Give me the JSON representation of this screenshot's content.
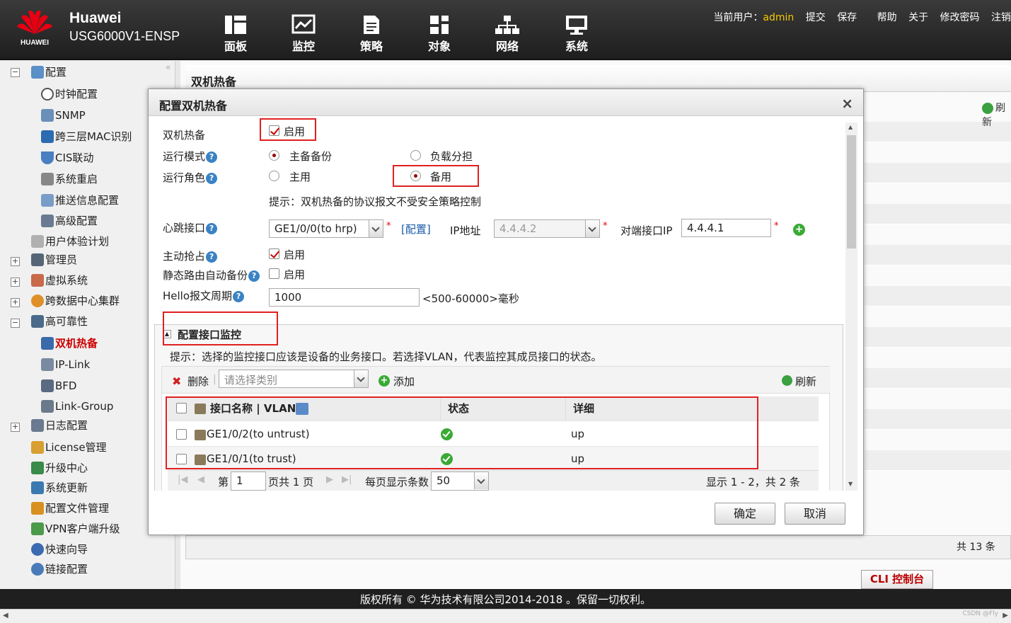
{
  "header": {
    "brand": "Huawei",
    "logo_text": "HUAWEI",
    "model": "USG6000V1-ENSP",
    "nav": [
      {
        "label": "面板",
        "icon": "dashboard-icon"
      },
      {
        "label": "监控",
        "icon": "monitor-icon"
      },
      {
        "label": "策略",
        "icon": "policy-icon"
      },
      {
        "label": "对象",
        "icon": "object-icon"
      },
      {
        "label": "网络",
        "icon": "network-icon"
      },
      {
        "label": "系统",
        "icon": "system-icon"
      }
    ],
    "user_prefix": "当前用户：",
    "user": "admin",
    "links": [
      "提交",
      "保存",
      "帮助",
      "关于",
      "修改密码",
      "注销"
    ]
  },
  "sidebar": {
    "root": "配置",
    "children": [
      "时钟配置",
      "SNMP",
      "跨三层MAC识别",
      "CIS联动",
      "系统重启",
      "推送信息配置",
      "高级配置"
    ],
    "items": [
      "用户体验计划",
      "管理员",
      "虚拟系统",
      "跨数据中心集群",
      "高可靠性"
    ],
    "ha_children": [
      "双机热备",
      "IP-Link",
      "BFD",
      "Link-Group"
    ],
    "items2": [
      "日志配置",
      "License管理",
      "升级中心",
      "系统更新",
      "配置文件管理",
      "VPN客户端升级",
      "快速向导",
      "链接配置"
    ]
  },
  "main": {
    "title": "双机热备",
    "refresh": "刷新",
    "total": "共 13 条",
    "cli": "CLI 控制台"
  },
  "footer": "版权所有 © 华为技术有限公司2014-2018 。保留一切权利。",
  "dialog": {
    "title": "配置双机热备",
    "close": "×",
    "ha_label": "双机热备",
    "ha_enable": "启用",
    "mode_label": "运行模式",
    "mode_options": [
      "主备备份",
      "负载分担"
    ],
    "role_label": "运行角色",
    "role_options": [
      "主用",
      "备用"
    ],
    "hint1": "提示：双机热备的协议报文不受安全策略控制",
    "hb_label": "心跳接口",
    "hb_value": "GE1/0/0(to hrp)",
    "hb_config": "[配置]",
    "ip_label": "IP地址",
    "ip_value": "4.4.4.2",
    "peer_label": "对端接口IP",
    "peer_value": "4.4.4.1",
    "preempt_label": "主动抢占",
    "preempt_enable": "启用",
    "static_label": "静态路由自动备份",
    "static_enable": "启用",
    "hello_label": "Hello报文周期",
    "hello_value": "1000",
    "hello_range": "<500-60000>毫秒",
    "req_mark": "*",
    "help_mark": "?",
    "section_title": "配置接口监控",
    "hint2": "提示：选择的监控接口应该是设备的业务接口。若选择VLAN，代表监控其成员接口的状态。",
    "delete": "删除",
    "category_placeholder": "请选择类别",
    "add": "添加",
    "refresh": "刷新",
    "columns": [
      "接口名称 | VLAN",
      "状态",
      "详细"
    ],
    "rows": [
      {
        "name": "GE1/0/2(to untrust)",
        "detail": "up"
      },
      {
        "name": "GE1/0/1(to trust)",
        "detail": "up"
      }
    ],
    "pager": {
      "page_prefix": "第",
      "page": "1",
      "page_total": "页共 1 页",
      "per_page_label": "每页显示条数",
      "per_page": "50",
      "summary": "显示 1 - 2，共 2 条"
    },
    "ok": "确定",
    "cancel": "取消"
  },
  "watermark": "CSDN @Fly"
}
